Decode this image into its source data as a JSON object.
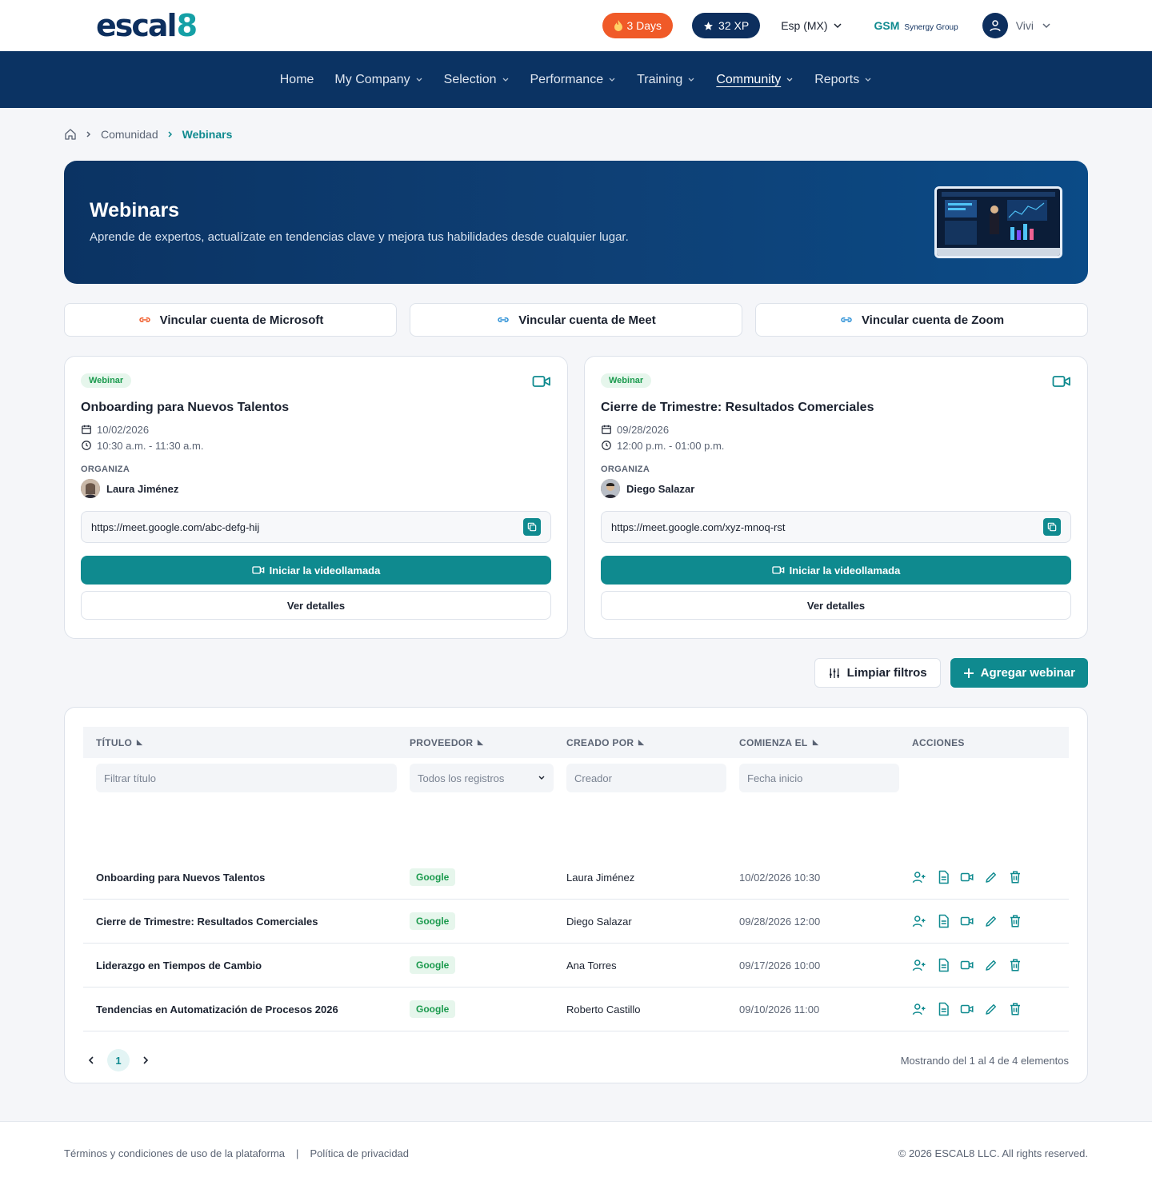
{
  "header": {
    "logo_text": "escal",
    "logo_digit": "8",
    "streak": "3 Days",
    "xp": "32 XP",
    "language": "Esp (MX)",
    "company_short": "GSM",
    "company_name": "Synergy Group",
    "user_name": "Vivi"
  },
  "nav": {
    "items": [
      {
        "label": "Home"
      },
      {
        "label": "My Company"
      },
      {
        "label": "Selection"
      },
      {
        "label": "Performance"
      },
      {
        "label": "Training"
      },
      {
        "label": "Community"
      },
      {
        "label": "Reports"
      }
    ],
    "active": "Community"
  },
  "breadcrumb": {
    "parent": "Comunidad",
    "current": "Webinars"
  },
  "hero": {
    "title": "Webinars",
    "subtitle": "Aprende de expertos, actualízate en tendencias clave y mejora tus habilidades desde cualquier lugar."
  },
  "link_buttons": [
    {
      "label": "Vincular cuenta de Microsoft",
      "color": "#f05a28"
    },
    {
      "label": "Vincular cuenta de Meet",
      "color": "#2a8fd6"
    },
    {
      "label": "Vincular cuenta de Zoom",
      "color": "#2a8fd6"
    }
  ],
  "cards": [
    {
      "badge": "Webinar",
      "title": "Onboarding para Nuevos Talentos",
      "date": "10/02/2026",
      "time": "10:30 a.m. - 11:30 a.m.",
      "organizer_label": "ORGANIZA",
      "organizer": "Laura Jiménez",
      "url": "https://meet.google.com/abc-defg-hij",
      "start_label": "Iniciar la videollamada",
      "details_label": "Ver detalles"
    },
    {
      "badge": "Webinar",
      "title": "Cierre de Trimestre: Resultados Comerciales",
      "date": "09/28/2026",
      "time": "12:00 p.m. - 01:00 p.m.",
      "organizer_label": "ORGANIZA",
      "organizer": "Diego Salazar",
      "url": "https://meet.google.com/xyz-mnoq-rst",
      "start_label": "Iniciar la videollamada",
      "details_label": "Ver detalles"
    }
  ],
  "toolbar": {
    "clear_label": "Limpiar filtros",
    "add_label": "Agregar webinar"
  },
  "table": {
    "headers": [
      "TÍTULO",
      "PROVEEDOR",
      "CREADO POR",
      "COMIENZA EL",
      "ACCIONES"
    ],
    "filters": {
      "title_placeholder": "Filtrar título",
      "provider_value": "Todos los registros",
      "creator_placeholder": "Creador",
      "date_placeholder": "Fecha inicio"
    },
    "rows": [
      {
        "title": "Onboarding para Nuevos Talentos",
        "provider": "Google",
        "creator": "Laura Jiménez",
        "start": "10/02/2026 10:30"
      },
      {
        "title": "Cierre de Trimestre: Resultados Comerciales",
        "provider": "Google",
        "creator": "Diego Salazar",
        "start": "09/28/2026 12:00"
      },
      {
        "title": "Liderazgo en Tiempos de Cambio",
        "provider": "Google",
        "creator": "Ana Torres",
        "start": "09/17/2026 10:00"
      },
      {
        "title": "Tendencias en Automatización de Procesos 2026",
        "provider": "Google",
        "creator": "Roberto Castillo",
        "start": "09/10/2026 11:00"
      }
    ],
    "page": "1",
    "showing": "Mostrando del 1 al 4 de 4 elementos"
  },
  "footer": {
    "terms": "Términos y condiciones de uso de la plataforma",
    "separator": "|",
    "privacy": "Política de privacidad",
    "copyright": "© 2026 ESCAL8 LLC. All rights reserved."
  },
  "colors": {
    "primary": "#0f8a8f",
    "navy": "#0b3363",
    "streak": "#f05a28"
  }
}
